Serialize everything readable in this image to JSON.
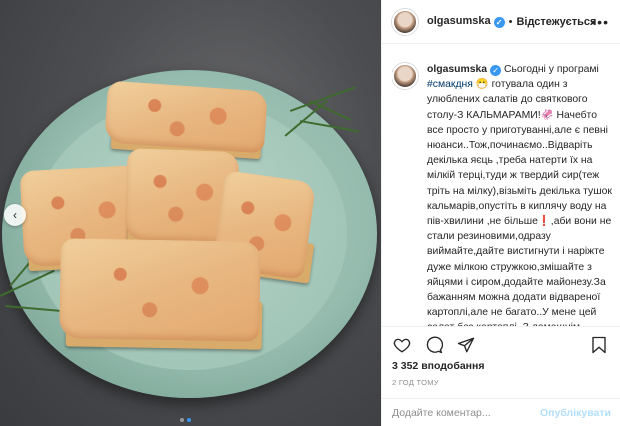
{
  "post": {
    "username": "olgasumska",
    "follow_label": "Відстежується",
    "separator": "•",
    "more_glyph": "•••"
  },
  "caption": {
    "username": "olgasumska",
    "text_intro": "Сьогодні у програмі",
    "hashtag": "#смакдня",
    "text_body": "😷 готувала один з улюблених салатів до святкового столу-З КАЛЬМАРАМИ!🦑 Начебто все просто у приготуванні,але є певні нюанси..Тож,починаємо..Відваріть декілька яєць ,треба натерти їх на мілкій терці,туди ж твердий сир(теж тріть на мілку),візьміть декілька тушок кальмарів,опустіть в киплячу воду на пів-хвилини ,не більше❗️,аби вони не стали резиновими,одразу виймайте,дайте вистигнути і наріжте дуже мілкою стружкою,змішайте з яйцями і сиром,додайте майонезу.За бажанням можна додати відвареної картоплі,але не багато..У мене цей салат без картоплі..З домашнім майонезом,який дуже легко зробити"
  },
  "actions": {
    "like_icon": "heart-icon",
    "comment_icon": "comment-icon",
    "share_icon": "share-icon",
    "save_icon": "bookmark-icon"
  },
  "likes": "3 352 вподобання",
  "time_ago": "2 год тому",
  "comment": {
    "placeholder": "Додайте коментар...",
    "post_label": "Опублікувати"
  },
  "carousel": {
    "prev_glyph": "‹",
    "slide_count": 2,
    "active_slide": 2
  },
  "colors": {
    "accent": "#3897f0",
    "post_button": "#b2dffc",
    "hashtag": "#00376b"
  }
}
